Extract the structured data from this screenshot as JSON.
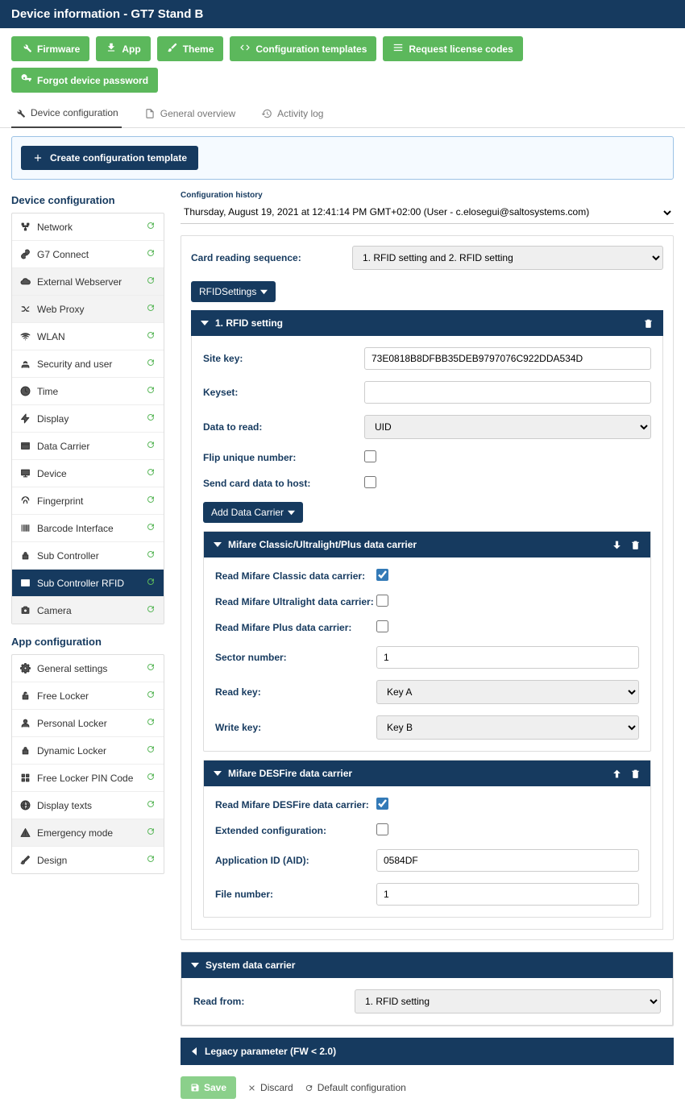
{
  "header": {
    "title": "Device information - GT7 Stand B"
  },
  "toolbar": [
    {
      "label": "Firmware"
    },
    {
      "label": "App"
    },
    {
      "label": "Theme"
    },
    {
      "label": "Configuration templates"
    },
    {
      "label": "Request license codes"
    },
    {
      "label": "Forgot device password"
    }
  ],
  "tabs": [
    {
      "label": "Device configuration"
    },
    {
      "label": "General overview"
    },
    {
      "label": "Activity log"
    }
  ],
  "callout": {
    "create": "Create configuration template"
  },
  "sidebar": {
    "device_title": "Device configuration",
    "device_items": [
      {
        "label": "Network"
      },
      {
        "label": "G7 Connect"
      },
      {
        "label": "External Webserver"
      },
      {
        "label": "Web Proxy"
      },
      {
        "label": "WLAN"
      },
      {
        "label": "Security and user"
      },
      {
        "label": "Time"
      },
      {
        "label": "Display"
      },
      {
        "label": "Data Carrier"
      },
      {
        "label": "Device"
      },
      {
        "label": "Fingerprint"
      },
      {
        "label": "Barcode Interface"
      },
      {
        "label": "Sub Controller"
      },
      {
        "label": "Sub Controller RFID"
      },
      {
        "label": "Camera"
      }
    ],
    "app_title": "App configuration",
    "app_items": [
      {
        "label": "General settings"
      },
      {
        "label": "Free Locker"
      },
      {
        "label": "Personal Locker"
      },
      {
        "label": "Dynamic Locker"
      },
      {
        "label": "Free Locker PIN Code"
      },
      {
        "label": "Display texts"
      },
      {
        "label": "Emergency mode"
      },
      {
        "label": "Design"
      }
    ]
  },
  "history": {
    "label": "Configuration history",
    "value": "Thursday, August 19, 2021 at 12:41:14 PM GMT+02:00 (User - c.elosegui@saltosystems.com)"
  },
  "cardseq": {
    "label": "Card reading sequence:",
    "value": "1. RFID setting and 2. RFID setting"
  },
  "rfid_tab": "RFIDSettings",
  "rfid1": {
    "title": "1. RFID setting",
    "sitekey_label": "Site key:",
    "sitekey_value": "73E0818B8DFBB35DEB9797076C922DDA534D",
    "keyset_label": "Keyset:",
    "keyset_value": "",
    "datatoread_label": "Data to read:",
    "datatoread_value": "UID",
    "flip_label": "Flip unique number:",
    "sendhost_label": "Send card data to host:",
    "add_dc": "Add Data Carrier",
    "mifare_classic": {
      "title": "Mifare Classic/Ultralight/Plus data carrier",
      "read_classic": "Read Mifare Classic data carrier:",
      "read_ultra": "Read Mifare Ultralight data carrier:",
      "read_plus": "Read Mifare Plus data carrier:",
      "sector_label": "Sector number:",
      "sector_value": "1",
      "readkey_label": "Read key:",
      "readkey_value": "Key A",
      "writekey_label": "Write key:",
      "writekey_value": "Key B"
    },
    "mifare_desfire": {
      "title": "Mifare DESFire data carrier",
      "read_desfire": "Read Mifare DESFire data carrier:",
      "extconf": "Extended configuration:",
      "aid_label": "Application ID (AID):",
      "aid_value": "0584DF",
      "file_label": "File number:",
      "file_value": "1"
    }
  },
  "sysdc": {
    "title": "System data carrier",
    "readfrom_label": "Read from:",
    "readfrom_value": "1. RFID setting"
  },
  "legacy": "Legacy parameter (FW < 2.0)",
  "actions": {
    "save": "Save",
    "discard": "Discard",
    "default": "Default configuration"
  }
}
